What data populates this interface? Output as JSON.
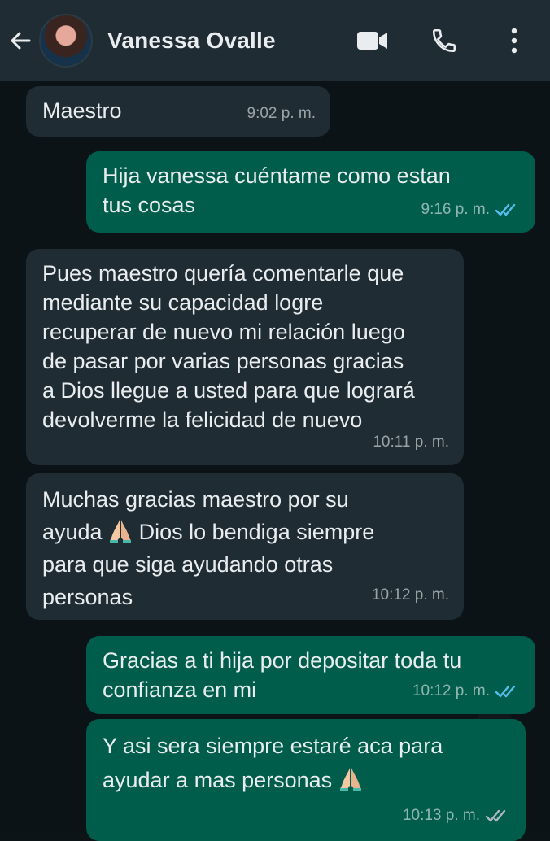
{
  "contact": {
    "name": "Vanessa Ovalle"
  },
  "icons": {
    "back": "arrow-left-icon",
    "video": "video-call-icon",
    "call": "phone-icon",
    "menu": "more-vert-icon",
    "read": "double-check-icon",
    "emoji": "folded-hands-emoji"
  },
  "colors": {
    "header": "#1f2c33",
    "incoming": "#1f2c33",
    "outgoing": "#005c4b",
    "read_tick": "#53bdeb"
  },
  "messages": [
    {
      "dir": "in",
      "text": "Maestro",
      "time": "9:02 p. m."
    },
    {
      "dir": "out",
      "text_lines": [
        "Hija vanessa cuéntame como estan",
        "tus cosas"
      ],
      "time": "9:16 p. m.",
      "status": "read"
    },
    {
      "dir": "in",
      "text_lines": [
        "Pues maestro quería comentarle que",
        "mediante su capacidad logre",
        "recuperar de nuevo mi relación luego",
        "de pasar por varias personas  gracias",
        "a Dios llegue a usted para que logrará",
        "devolverme la felicidad de nuevo"
      ],
      "time": "10:11 p. m."
    },
    {
      "dir": "in",
      "line1": "Muchas gracias maestro por su",
      "line2_before": "ayuda ",
      "line2_after": " Dios lo bendiga siempre",
      "line3": "para que siga ayudando otras",
      "line4": "personas",
      "time": "10:12 p. m."
    },
    {
      "dir": "out",
      "text_lines": [
        "Gracias a ti hija por depositar toda tu",
        "confianza en mi"
      ],
      "time": "10:12 p. m.",
      "status": "read"
    },
    {
      "dir": "out",
      "line1": "Y asi sera siempre estaré aca para",
      "line2": "ayudar a mas personas ",
      "time": "10:13 p. m.",
      "status": "delivered"
    }
  ]
}
